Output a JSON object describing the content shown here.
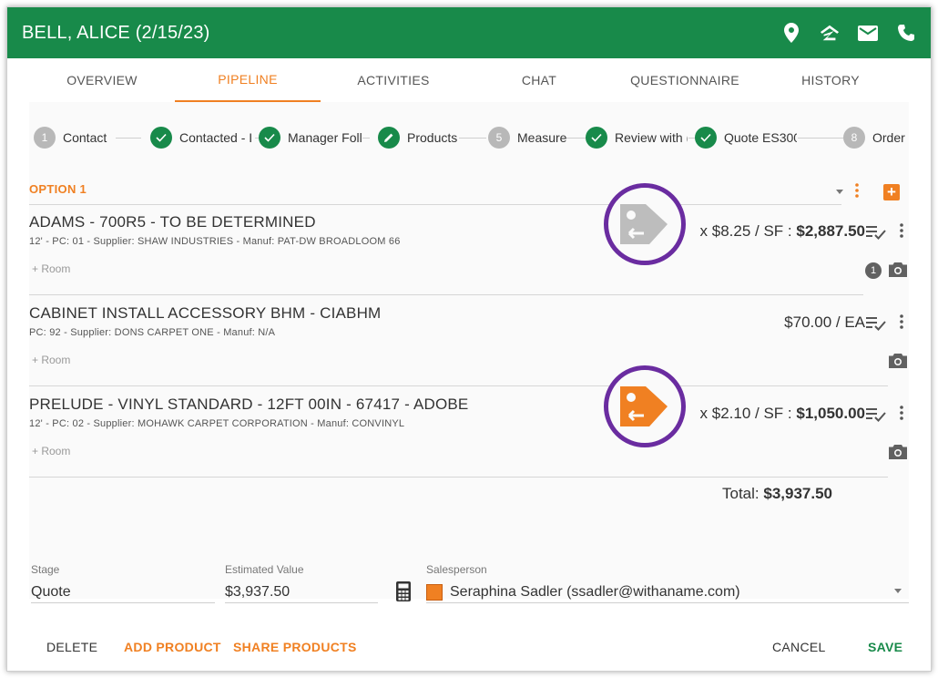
{
  "header": {
    "title": "BELL, ALICE (2/15/23)",
    "icons": [
      "location-pin-icon",
      "zillow-icon",
      "mail-icon",
      "phone-icon"
    ]
  },
  "tabs": [
    {
      "label": "OVERVIEW",
      "active": false
    },
    {
      "label": "PIPELINE",
      "active": true
    },
    {
      "label": "ACTIVITIES",
      "active": false
    },
    {
      "label": "CHAT",
      "active": false
    },
    {
      "label": "QUESTIONNAIRE",
      "active": false
    },
    {
      "label": "HISTORY",
      "active": false
    }
  ],
  "stepper": {
    "steps": [
      {
        "marker": "1",
        "state": "number",
        "label": "Contact"
      },
      {
        "marker": "",
        "state": "done",
        "label": "Contacted - I"
      },
      {
        "marker": "",
        "state": "done",
        "label": "Manager Foll"
      },
      {
        "marker": "",
        "state": "edit",
        "label": "Products"
      },
      {
        "marker": "5",
        "state": "number",
        "label": "Measure"
      },
      {
        "marker": "",
        "state": "done",
        "label": "Review with ("
      },
      {
        "marker": "",
        "state": "done",
        "label": "Quote ES300"
      },
      {
        "marker": "8",
        "state": "number",
        "label": "Order"
      }
    ]
  },
  "option": {
    "title": "OPTION 1",
    "add_label": "+"
  },
  "products": [
    {
      "name": "ADAMS - 700R5 - TO BE DETERMINED",
      "desc": "12' - PC: 01 - Supplier: SHAW INDUSTRIES - Manuf: PAT-DW BROADLOOM 66",
      "room": "+ Room",
      "price_text": "x $8.25 / SF : ",
      "price_total": "$2,887.50",
      "tag": "gray",
      "photo_count": "1"
    },
    {
      "name": "CABINET INSTALL ACCESSORY BHM - CIABHM",
      "desc": "PC: 92 - Supplier: DONS CARPET ONE - Manuf: N/A",
      "room": "+ Room",
      "price_text": "$70.00 / EA",
      "price_total": "",
      "tag": "none",
      "photo_count": ""
    },
    {
      "name": "PRELUDE - VINYL STANDARD - 12FT 00IN - 67417 - ADOBE",
      "desc": "12' - PC: 02 - Supplier: MOHAWK CARPET CORPORATION - Manuf: CONVINYL",
      "room": "+ Room",
      "price_text": "x $2.10 / SF : ",
      "price_total": "$1,050.00",
      "tag": "orange",
      "photo_count": ""
    }
  ],
  "total": {
    "label": "Total: ",
    "value": "$3,937.50"
  },
  "fields": {
    "stage": {
      "label": "Stage",
      "value": "Quote"
    },
    "estimated_value": {
      "label": "Estimated Value",
      "value": "$3,937.50"
    },
    "salesperson": {
      "label": "Salesperson",
      "value": "Seraphina Sadler (ssadler@withaname.com)",
      "color": "#f08022"
    }
  },
  "footer": {
    "delete": "DELETE",
    "add_product": "ADD PRODUCT",
    "share_products": "SHARE PRODUCTS",
    "cancel": "CANCEL",
    "save": "SAVE"
  },
  "colors": {
    "brand_green": "#188a4a",
    "accent_orange": "#f08022",
    "highlight_purple": "#6a2ca0"
  }
}
